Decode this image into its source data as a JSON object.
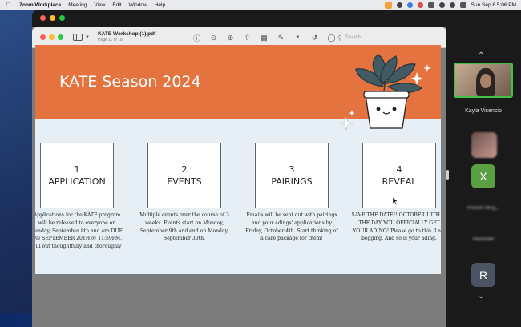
{
  "menubar": {
    "app": "Zoom Workplace",
    "items": [
      "Meeting",
      "View",
      "Edit",
      "Window",
      "Help"
    ],
    "clock": "Sun Sep 8  5:06 PM"
  },
  "preview": {
    "doc_title": "KATE Workshop (1).pdf",
    "page_info": "Page 11 of 18",
    "search_placeholder": "Search"
  },
  "slide": {
    "title": "KATE Season 2024",
    "cards": [
      {
        "num": "1",
        "label": "APPLICATION",
        "desc": "Applications for the KATE program will be released to everyone on Sunday, September 8th and are DUE ON SEPTEMBER 20TH @ 11:59PM. Fill out thoughtfully and thoroughly"
      },
      {
        "num": "2",
        "label": "EVENTS",
        "desc": "Multiple events over the course of 3 weeks. Events start on Monday, September 9th and end on Monday, September 30th."
      },
      {
        "num": "3",
        "label": "PAIRINGS",
        "desc": "Emails will be sent out with pairings and your adings' applications by Friday, October 4th. Start thinking of a care package for them!"
      },
      {
        "num": "4",
        "label": "REVEAL",
        "desc": "SAVE THE DATE!! OCTOBER 10TH IS THE DAY YOU OFFICIALLY GET YOUR ADING! Please go to this. I am begging. And so is your ading."
      }
    ]
  },
  "participants": {
    "active_name": "Kayla Vicencio",
    "x_initial": "X",
    "x_name": "Preston Ming...",
    "blur_name": "Alexander",
    "r_initial": "R"
  },
  "colors": {
    "slide_header": "#e4733f",
    "slide_bg": "#e6eff5",
    "active_speaker_border": "#43c04b"
  }
}
